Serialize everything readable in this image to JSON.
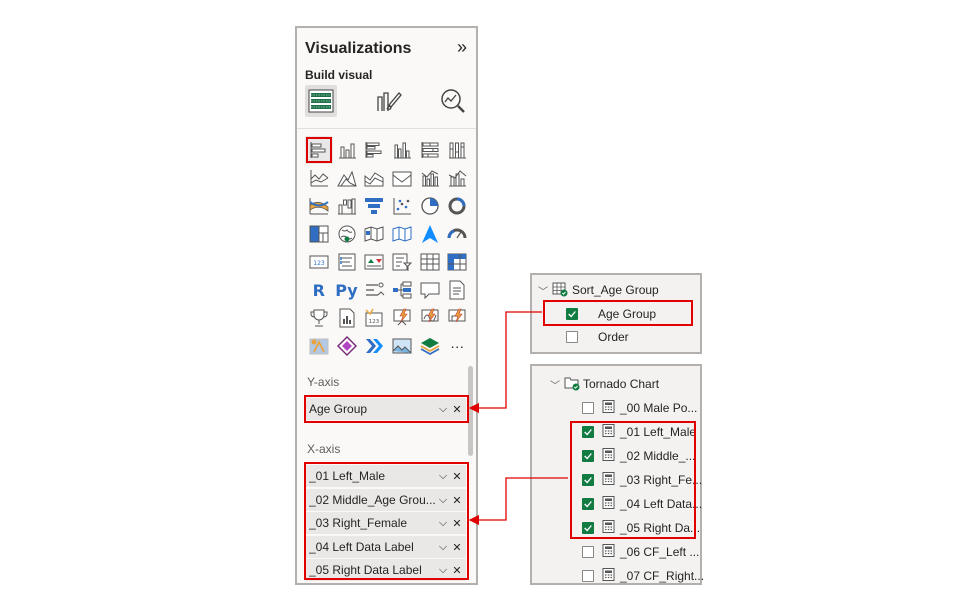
{
  "pane": {
    "title": "Visualizations",
    "build_visual_label": "Build visual",
    "tabs": [
      "Build visual",
      "Format visual",
      "Analytics"
    ]
  },
  "wells": {
    "y_axis": {
      "header": "Y-axis",
      "fields": [
        {
          "label": "Age Group"
        }
      ]
    },
    "x_axis": {
      "header": "X-axis",
      "fields": [
        {
          "label": "_01 Left_Male"
        },
        {
          "label": "_02 Middle_Age Grou..."
        },
        {
          "label": "_03 Right_Female"
        },
        {
          "label": "_04 Left Data Label"
        },
        {
          "label": "_05 Right Data Label"
        }
      ]
    }
  },
  "sort_table": {
    "name": "Sort_Age Group",
    "fields": [
      {
        "label": "Age Group",
        "checked": true
      },
      {
        "label": "Order",
        "checked": false
      }
    ]
  },
  "tornado_table": {
    "name": "Tornado Chart",
    "fields": [
      {
        "label": "_00 Male Po...",
        "checked": false
      },
      {
        "label": "_01 Left_Male",
        "checked": true
      },
      {
        "label": "_02 Middle_...",
        "checked": true
      },
      {
        "label": "_03 Right_Fe...",
        "checked": true
      },
      {
        "label": "_04 Left Data...",
        "checked": true
      },
      {
        "label": "_05 Right Da...",
        "checked": true
      },
      {
        "label": "_06 CF_Left ...",
        "checked": false
      },
      {
        "label": "_07 CF_Right...",
        "checked": false
      }
    ]
  },
  "gallery_text": {
    "r_visual": "R",
    "python_visual": "Py",
    "more": "···"
  },
  "colors": {
    "highlight": "#e00000",
    "check": "#107c41",
    "accent_blue": "#2f6ec3",
    "accent_teal": "#118dff"
  }
}
